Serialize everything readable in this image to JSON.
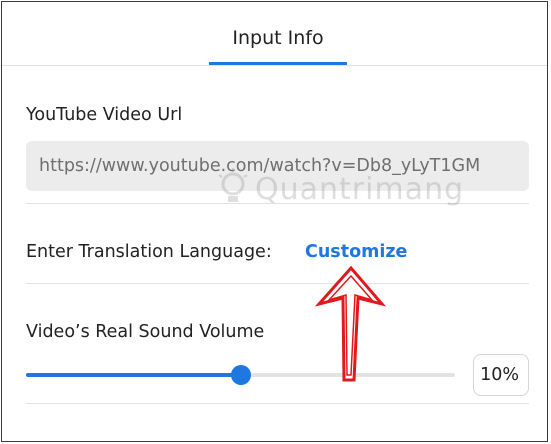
{
  "tabs": [
    {
      "label": "Input Info",
      "active": true
    }
  ],
  "youtube_url": {
    "label": "YouTube Video Url",
    "value": "https://www.youtube.com/watch?v=Db8_yLyT1GM"
  },
  "translation": {
    "label": "Enter Translation Language:",
    "customize_label": "Customize"
  },
  "volume": {
    "label": "Video’s Real Sound Volume",
    "percent": 50,
    "display": "10%"
  },
  "watermark": {
    "text": "Quantrimang"
  },
  "colors": {
    "accent": "#1f77e0",
    "annotation_arrow": "#e0191c"
  },
  "icons": {
    "annotation": "red-up-arrow",
    "watermark_logo": "lightbulb-logo"
  }
}
